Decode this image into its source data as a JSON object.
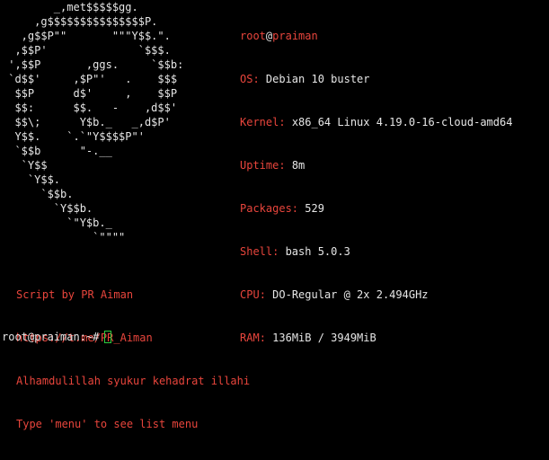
{
  "logo_lines": [
    "        _,met$$$$$gg.",
    "     ,g$$$$$$$$$$$$$$$P.",
    "   ,g$$P\"\"       \"\"\"Y$$.\".",
    "  ,$$P'              `$$$.",
    " ',$$P       ,ggs.     `$$b:",
    " `d$$'     ,$P\"'   .    $$$",
    "  $$P      d$'     ,    $$P",
    "  $$:      $$.   -    ,d$$'",
    "  $$\\;      Y$b._   _,d$P'",
    "  Y$$.    `.`\"Y$$$$P\"'",
    "  `$$b      \"-.__",
    "   `Y$$",
    "    `Y$$.",
    "      `$$b.",
    "        `Y$$b.",
    "          `\"Y$b._",
    "              `\"\"\"\""
  ],
  "info": {
    "user": "root",
    "at": "@",
    "host": "praiman",
    "fields": [
      {
        "key": "OS",
        "value": "Debian 10 buster"
      },
      {
        "key": "Kernel",
        "value": "x86_64 Linux 4.19.0-16-cloud-amd64"
      },
      {
        "key": "Uptime",
        "value": "8m"
      },
      {
        "key": "Packages",
        "value": "529"
      },
      {
        "key": "Shell",
        "value": "bash 5.0.3"
      },
      {
        "key": "CPU",
        "value": "DO-Regular @ 2x 2.494GHz"
      },
      {
        "key": "RAM",
        "value": "136MiB / 3949MiB"
      }
    ]
  },
  "script": {
    "line1": "Script by PR Aiman",
    "line2": "https://t.me/PR_Aiman",
    "line3": "Alhamdulillah syukur kehadrat illahi",
    "line4": "Type 'menu' to see list menu"
  },
  "prompt": {
    "text": "root@praiman:~#"
  },
  "colors": {
    "background": "#000000",
    "accent": "#e8453c",
    "text": "#e6e6e6",
    "cursor": "#2ecc40"
  }
}
